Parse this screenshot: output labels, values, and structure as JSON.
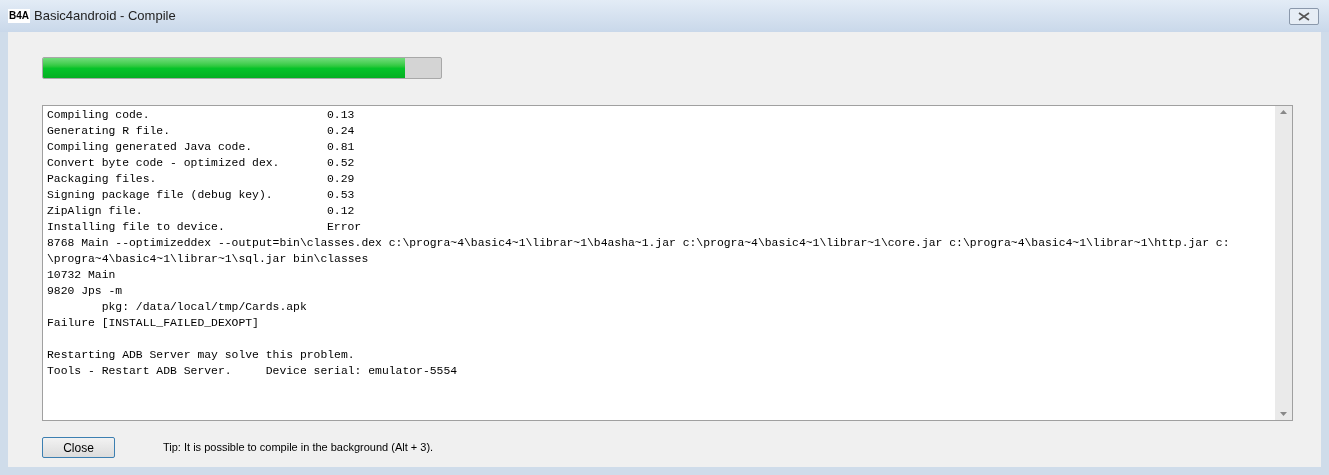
{
  "window": {
    "logo": "B4A",
    "title": "Basic4android - Compile"
  },
  "progress": {
    "level": 0.91
  },
  "log": [
    {
      "kind": "step",
      "label": "Compiling code.",
      "value": "0.13"
    },
    {
      "kind": "step",
      "label": "Generating R file.",
      "value": "0.24"
    },
    {
      "kind": "step",
      "label": "Compiling generated Java code.",
      "value": "0.81"
    },
    {
      "kind": "step",
      "label": "Convert byte code - optimized dex.",
      "value": "0.52"
    },
    {
      "kind": "step",
      "label": "Packaging files.",
      "value": "0.29"
    },
    {
      "kind": "step",
      "label": "Signing package file (debug key).",
      "value": "0.53"
    },
    {
      "kind": "step",
      "label": "ZipAlign file.",
      "value": "0.12"
    },
    {
      "kind": "step",
      "label": "Installing file to device.",
      "value": "Error"
    },
    {
      "kind": "text",
      "text": "8768 Main --optimizeddex --output=bin\\classes.dex c:\\progra~4\\basic4~1\\librar~1\\b4asha~1.jar c:\\progra~4\\basic4~1\\librar~1\\core.jar c:\\progra~4\\basic4~1\\librar~1\\http.jar c:"
    },
    {
      "kind": "text",
      "text": "\\progra~4\\basic4~1\\librar~1\\sql.jar bin\\classes"
    },
    {
      "kind": "text",
      "text": "10732 Main"
    },
    {
      "kind": "text",
      "text": "9820 Jps -m"
    },
    {
      "kind": "text",
      "text": "        pkg: /data/local/tmp/Cards.apk"
    },
    {
      "kind": "text",
      "text": "Failure [INSTALL_FAILED_DEXOPT]"
    },
    {
      "kind": "blank"
    },
    {
      "kind": "text",
      "text": "Restarting ADB Server may solve this problem."
    },
    {
      "kind": "text",
      "text": "Tools - Restart ADB Server.     Device serial: emulator-5554"
    }
  ],
  "close_button": "Close",
  "tip": "Tip: It is possible to compile in the background (Alt + 3)."
}
